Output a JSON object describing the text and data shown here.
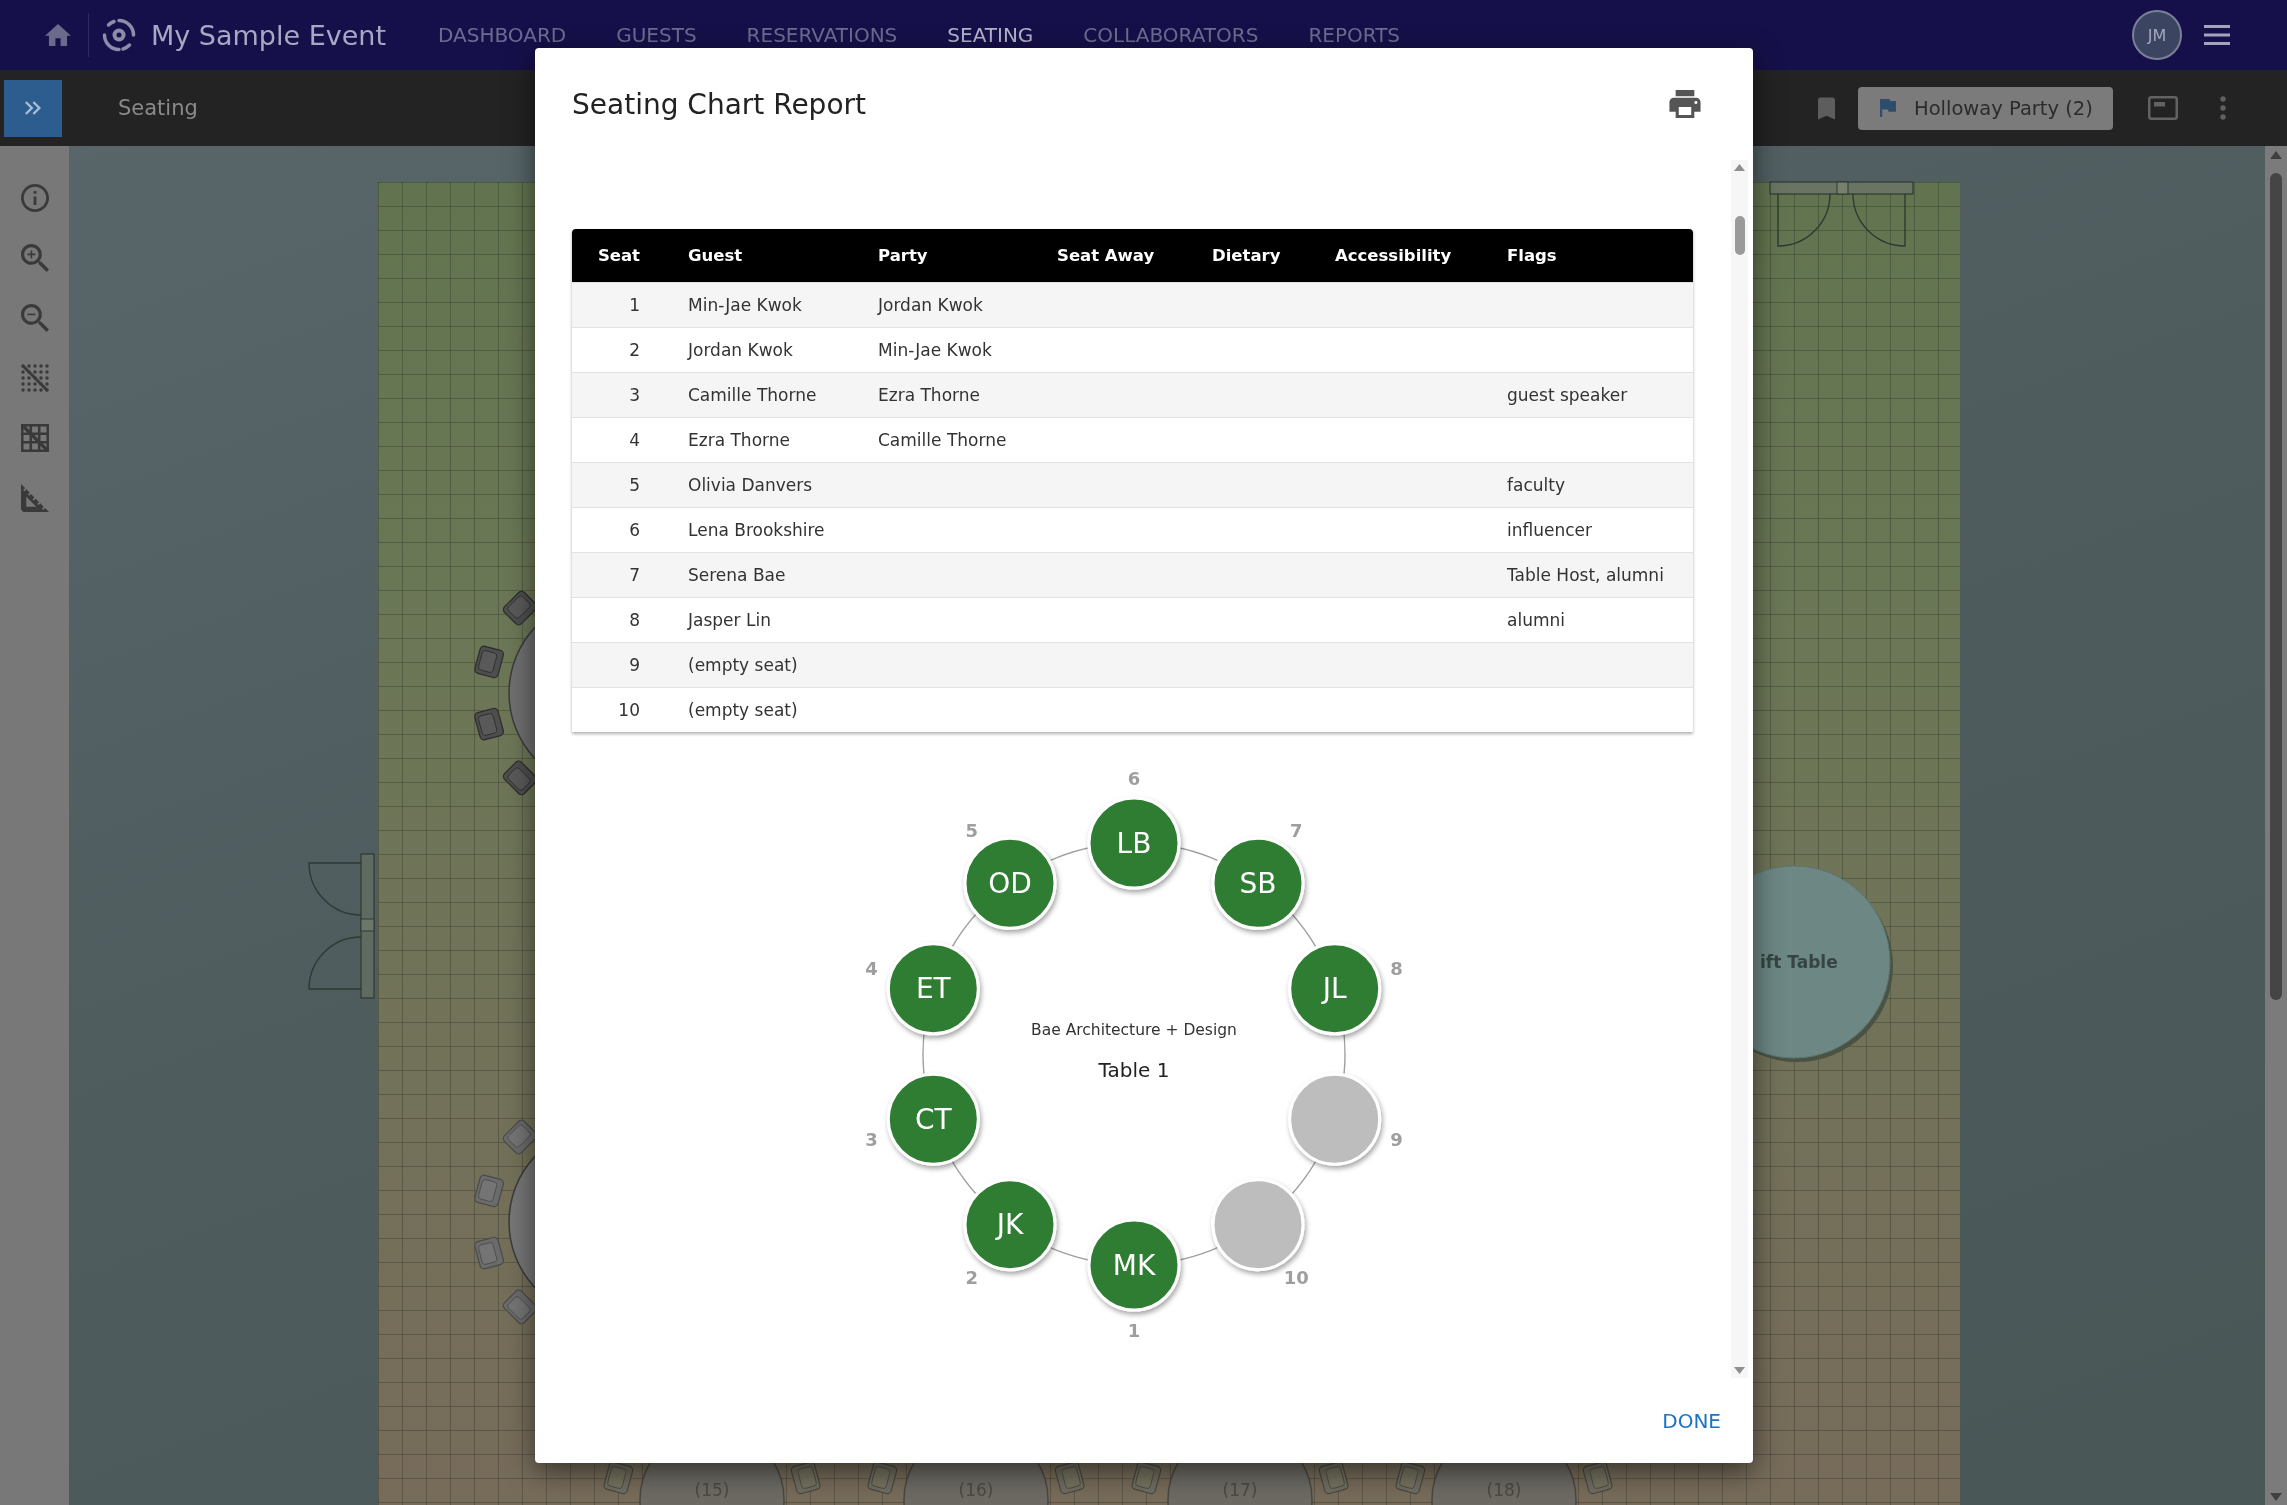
{
  "app_bar": {
    "title": "My Sample Event",
    "nav": [
      {
        "label": "DASHBOARD",
        "selected": false
      },
      {
        "label": "GUESTS",
        "selected": false
      },
      {
        "label": "RESERVATIONS",
        "selected": false
      },
      {
        "label": "SEATING",
        "selected": true
      },
      {
        "label": "COLLABORATORS",
        "selected": false
      },
      {
        "label": "REPORTS",
        "selected": false
      }
    ],
    "avatar": "JM"
  },
  "toolbar": {
    "title": "Seating",
    "party_button": "Holloway Party (2)"
  },
  "floor_plan": {
    "tables": [
      {
        "label": "(15)"
      },
      {
        "label": "(16)"
      },
      {
        "label": "(17)"
      },
      {
        "label": "(18)"
      }
    ],
    "gift_table": {
      "label": "ift Table"
    }
  },
  "modal": {
    "title": "Seating Chart Report",
    "table": {
      "columns": [
        "Seat",
        "Guest",
        "Party",
        "Seat Away",
        "Dietary",
        "Accessibility",
        "Flags"
      ],
      "rows": [
        {
          "seat": "1",
          "guest": "Min-Jae Kwok",
          "party": "Jordan Kwok"
        },
        {
          "seat": "2",
          "guest": "Jordan Kwok",
          "party": "Min-Jae Kwok"
        },
        {
          "seat": "3",
          "guest": "Camille Thorne",
          "party": "Ezra Thorne",
          "flags": "guest speaker"
        },
        {
          "seat": "4",
          "guest": "Ezra Thorne",
          "party": "Camille Thorne"
        },
        {
          "seat": "5",
          "guest": "Olivia Danvers",
          "flags": "faculty"
        },
        {
          "seat": "6",
          "guest": "Lena Brookshire",
          "flags": "influencer"
        },
        {
          "seat": "7",
          "guest": "Serena Bae",
          "flags": "Table Host, alumni"
        },
        {
          "seat": "8",
          "guest": "Jasper Lin",
          "flags": "alumni"
        },
        {
          "seat": "9",
          "guest": "(empty seat)"
        },
        {
          "seat": "10",
          "guest": "(empty seat)"
        }
      ]
    },
    "diagram": {
      "host": "Bae Architecture + Design",
      "table_name": "Table 1",
      "seats": [
        {
          "number": "6",
          "initials": "LB",
          "occupied": true
        },
        {
          "number": "5",
          "initials": "OD",
          "occupied": true
        },
        {
          "number": "7",
          "initials": "SB",
          "occupied": true
        },
        {
          "number": "4",
          "initials": "ET",
          "occupied": true
        },
        {
          "number": "8",
          "initials": "JL",
          "occupied": true
        },
        {
          "number": "3",
          "initials": "CT",
          "occupied": true
        },
        {
          "number": "9",
          "occupied": false
        },
        {
          "number": "2",
          "initials": "JK",
          "occupied": true
        },
        {
          "number": "10",
          "occupied": false
        },
        {
          "number": "1",
          "initials": "MK",
          "occupied": true
        }
      ]
    },
    "done_button": "DONE"
  }
}
